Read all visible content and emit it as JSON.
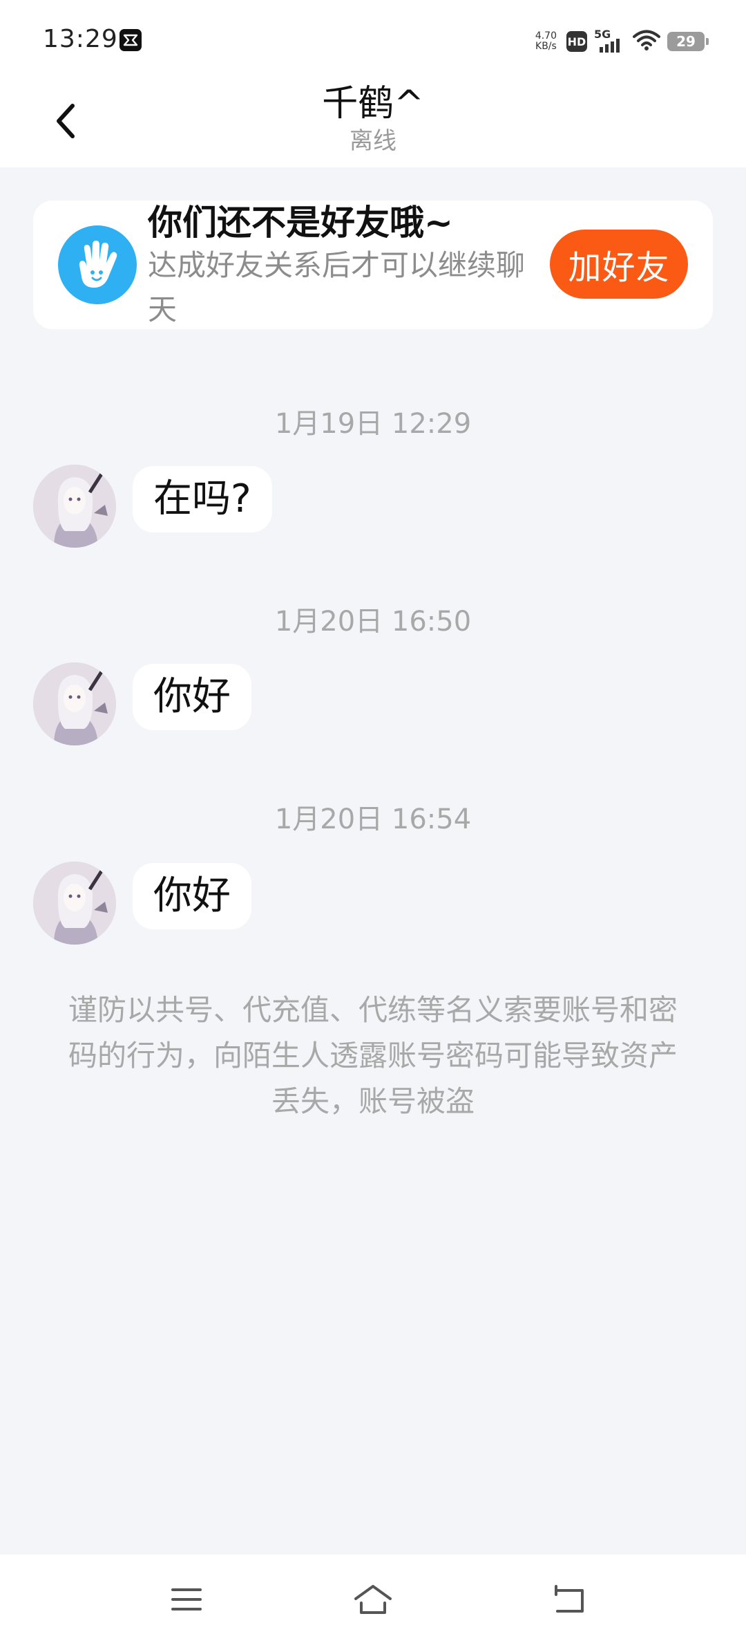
{
  "status_bar": {
    "time": "13:29",
    "speed_value": "4.70",
    "speed_unit": "KB/s",
    "hd": "HD",
    "network": "5G",
    "battery": "29"
  },
  "header": {
    "title": "千鹤^",
    "subtitle": "离线"
  },
  "friend_banner": {
    "title": "你们还不是好友哦~",
    "description": "达成好友关系后才可以继续聊天",
    "button": "加好友"
  },
  "messages": [
    {
      "timestamp": "1月19日 12:29",
      "text": "在吗?"
    },
    {
      "timestamp": "1月20日 16:50",
      "text": "你好"
    },
    {
      "timestamp": "1月20日 16:54",
      "text": "你好"
    }
  ],
  "warning": "谨防以共号、代充值、代练等名义索要账号和密码的行为，向陌生人透露账号密码可能导致资产丢失，账号被盗",
  "colors": {
    "accent": "#fb5a14",
    "icon_blue": "#2fb0f2",
    "background": "#f4f5f9"
  },
  "icons": {
    "back": "chevron-left-icon",
    "banner": "hand-icon",
    "nav": [
      "menu-icon",
      "home-icon",
      "back-nav-icon"
    ]
  }
}
